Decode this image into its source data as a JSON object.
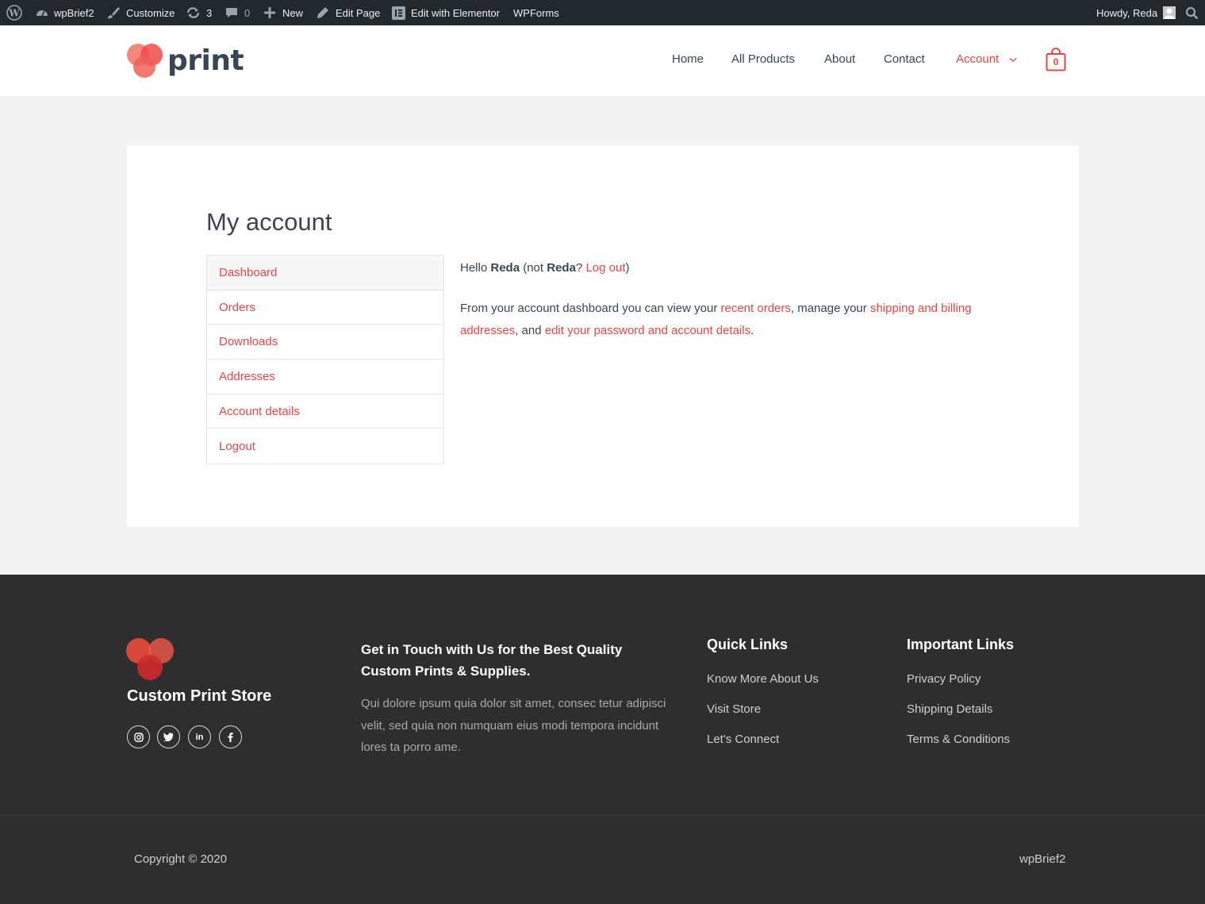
{
  "adminbar": {
    "site_name": "wpBrief2",
    "customize": "Customize",
    "updates_count": "3",
    "comments_count": "0",
    "new": "New",
    "edit_page": "Edit Page",
    "edit_elementor": "Edit with Elementor",
    "wpforms": "WPForms",
    "howdy": "Howdy, Reda"
  },
  "header": {
    "logo_text": "print",
    "nav": [
      "Home",
      "All Products",
      "About",
      "Contact",
      "Account"
    ],
    "cart_count": "0",
    "accent_color": "#e84545"
  },
  "main": {
    "title": "My account",
    "nav": [
      "Dashboard",
      "Orders",
      "Downloads",
      "Addresses",
      "Account details",
      "Logout"
    ],
    "hello_prefix": "Hello ",
    "username": "Reda",
    "not_prefix": " (not ",
    "username2": "Reda",
    "question": "? ",
    "logout_link": "Log out",
    "close_paren": ")",
    "intro_1": "From your account dashboard you can view your ",
    "link_recent_orders": "recent orders",
    "intro_2": ", manage your ",
    "link_addresses": "shipping and billing addresses",
    "intro_3": ", and ",
    "link_password": "edit your password and account details",
    "intro_4": "."
  },
  "footer": {
    "brand": "Custom Print Store",
    "social": [
      "instagram",
      "twitter",
      "linkedin",
      "facebook"
    ],
    "touch_title": "Get in Touch with Us for the Best Quality Custom Prints & Supplies.",
    "touch_text": "Qui dolore ipsum quia dolor sit amet, consec tetur adipisci velit, sed quia non numquam eius modi tempora incidunt lores ta porro ame.",
    "quick_title": "Quick Links",
    "quick_links": [
      "Know More About Us",
      "Visit Store",
      "Let's Connect"
    ],
    "important_title": "Important Links",
    "important_links": [
      "Privacy Policy",
      "Shipping Details",
      "Terms & Conditions"
    ],
    "copyright": "Copyright © 2020",
    "site_name": "wpBrief2"
  }
}
